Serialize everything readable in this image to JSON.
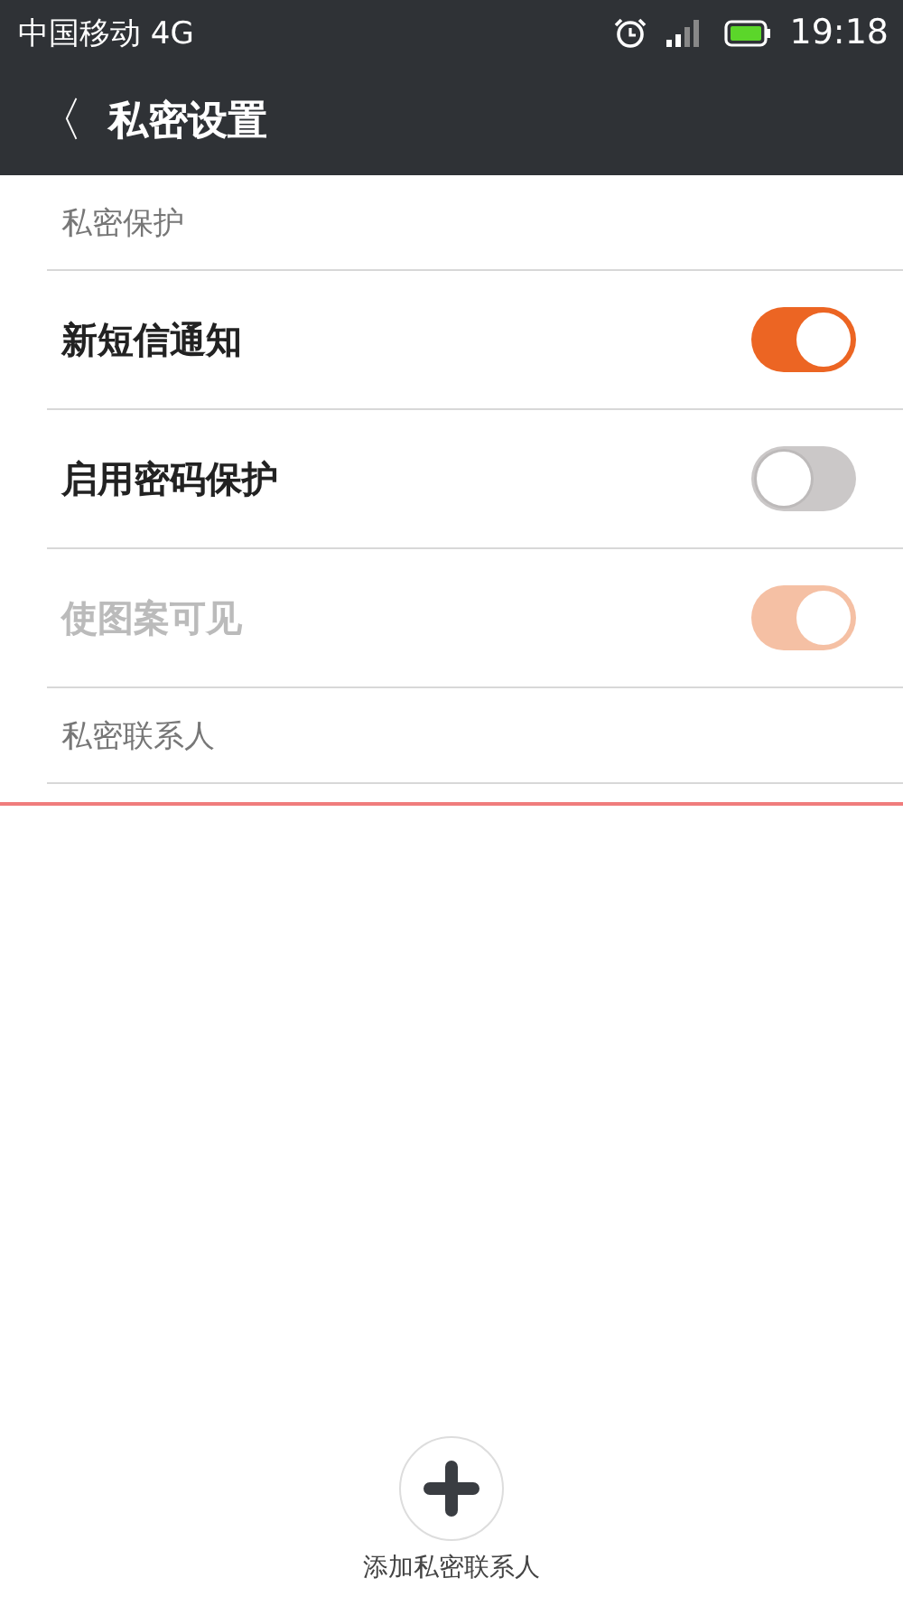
{
  "status_bar": {
    "carrier": "中国移动 4G",
    "time": "19:18"
  },
  "header": {
    "back": "〈",
    "title": "私密设置"
  },
  "sections": [
    {
      "title": "私密保护",
      "rows": [
        {
          "label": "新短信通知",
          "on": true,
          "disabled": false
        },
        {
          "label": "启用密码保护",
          "on": false,
          "disabled": false
        },
        {
          "label": "使图案可见",
          "on": true,
          "disabled": true
        }
      ]
    },
    {
      "title": "私密联系人"
    }
  ],
  "add_button": {
    "label": "添加私密联系人"
  }
}
